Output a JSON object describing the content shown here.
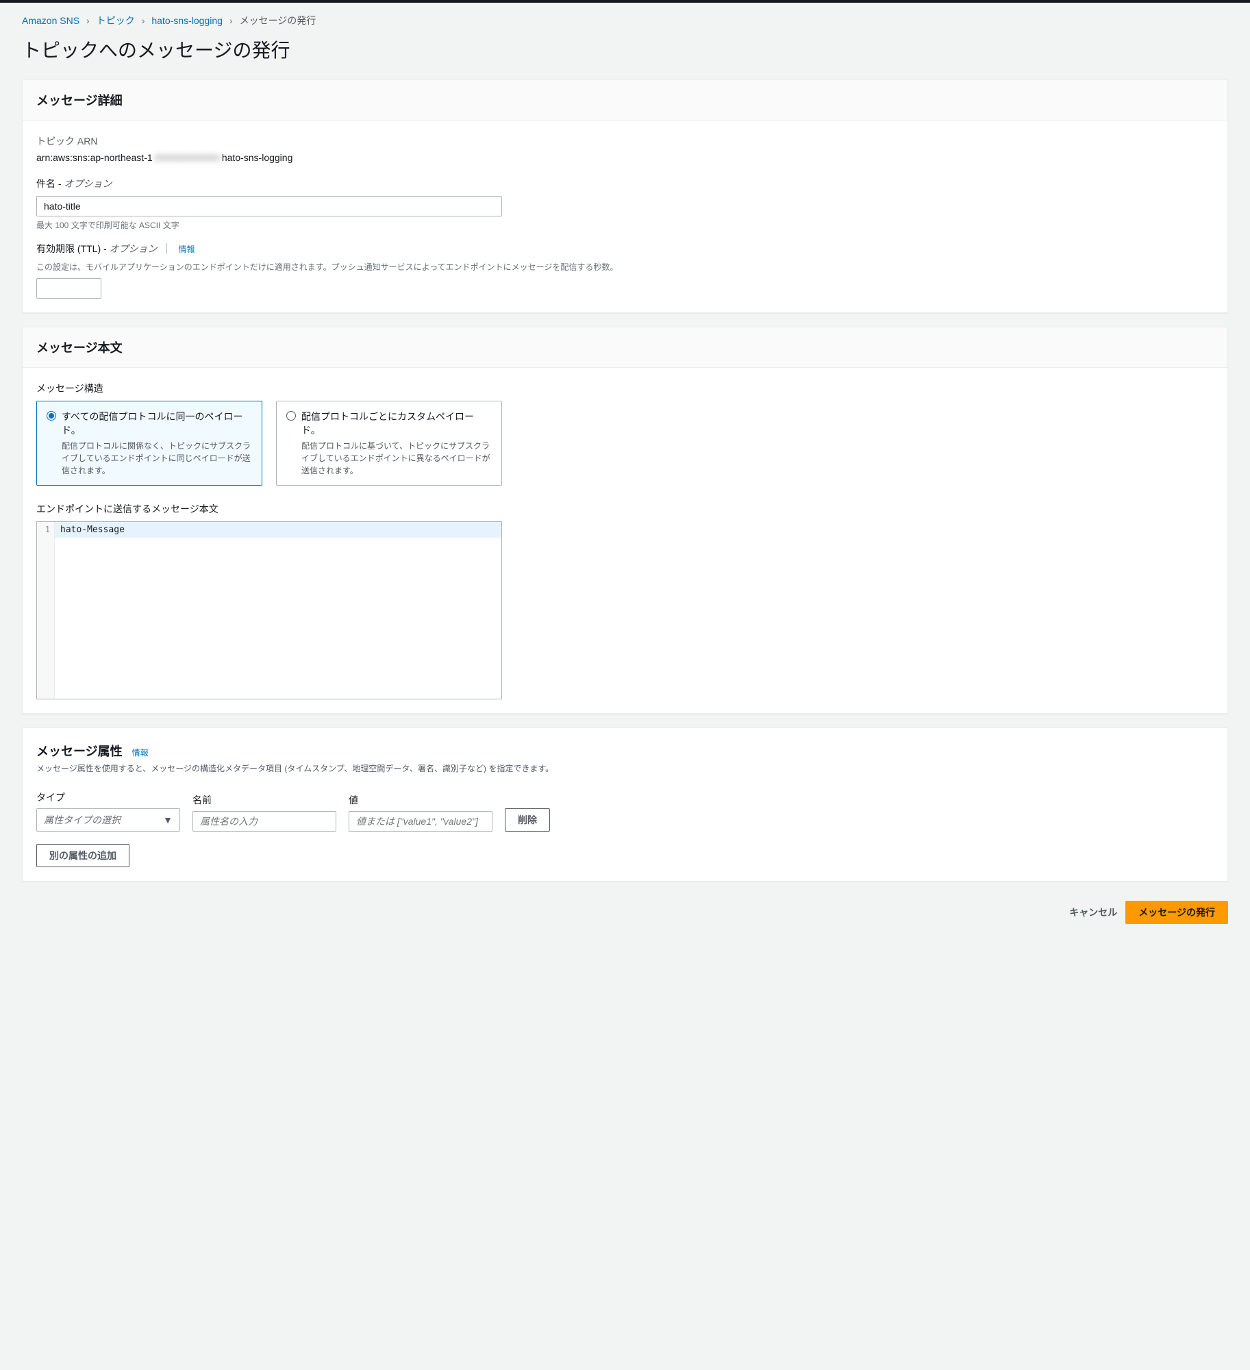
{
  "breadcrumb": {
    "items": [
      {
        "label": "Amazon SNS"
      },
      {
        "label": "トピック"
      },
      {
        "label": "hato-sns-logging"
      }
    ],
    "current": "メッセージの発行"
  },
  "page": {
    "title": "トピックへのメッセージの発行"
  },
  "details": {
    "heading": "メッセージ詳細",
    "arn_label": "トピック ARN",
    "arn_prefix": "arn:aws:sns:ap-northeast-1",
    "arn_suffix": "hato-sns-logging",
    "subject_label": "件名 - ",
    "subject_optional": "オプション",
    "subject_value": "hato-title",
    "subject_hint": "最大 100 文字で印刷可能な ASCII 文字",
    "ttl_label": "有効期限 (TTL) - ",
    "ttl_optional": "オプション",
    "info": "情報",
    "ttl_desc": "この設定は、モバイルアプリケーションのエンドポイントだけに適用されます。プッシュ通知サービスによってエンドポイントにメッセージを配信する秒数。"
  },
  "body": {
    "heading": "メッセージ本文",
    "structure_label": "メッセージ構造",
    "radio1": {
      "title": "すべての配信プロトコルに同一のペイロード。",
      "desc": "配信プロトコルに関係なく、トピックにサブスクライブしているエンドポイントに同じペイロードが送信されます。"
    },
    "radio2": {
      "title": "配信プロトコルごとにカスタムペイロード。",
      "desc": "配信プロトコルに基づいて、トピックにサブスクライブしているエンドポイントに異なるペイロードが送信されます。"
    },
    "message_label": "エンドポイントに送信するメッセージ本文",
    "line_number": "1",
    "message_value": "hato-Message"
  },
  "attrs": {
    "heading": "メッセージ属性",
    "info": "情報",
    "desc": "メッセージ属性を使用すると、メッセージの構造化メタデータ項目 (タイムスタンプ、地理空間データ、署名、識別子など) を指定できます。",
    "type_label": "タイプ",
    "type_placeholder": "属性タイプの選択",
    "name_label": "名前",
    "name_placeholder": "属性名の入力",
    "value_label": "値",
    "value_placeholder": "値または [\"value1\", \"value2\"]",
    "delete": "削除",
    "add": "別の属性の追加"
  },
  "footer": {
    "cancel": "キャンセル",
    "publish": "メッセージの発行"
  }
}
